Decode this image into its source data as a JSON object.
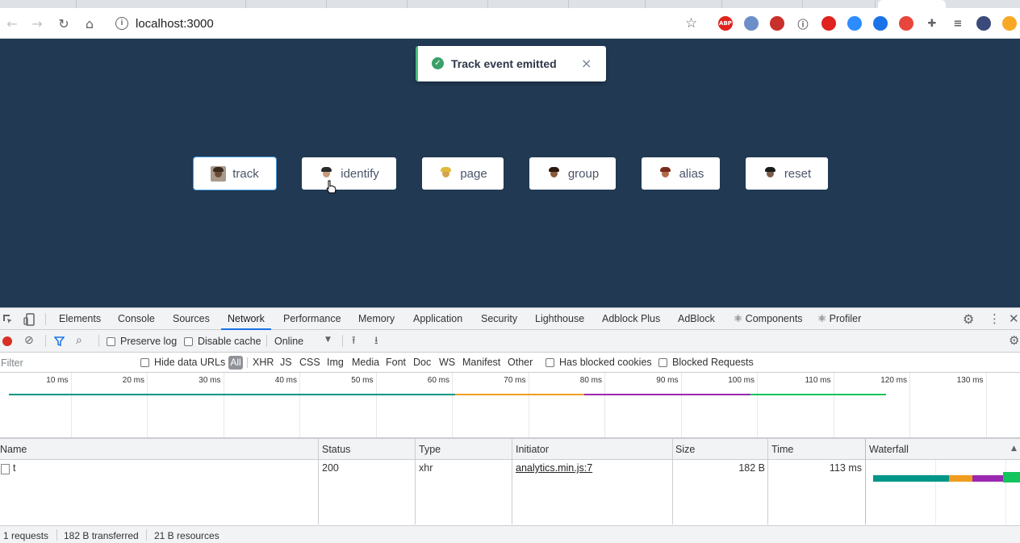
{
  "browser": {
    "url": "localhost:3000",
    "icons": {
      "back": "arrow-left-icon",
      "forward": "arrow-right-icon",
      "reload": "reload-icon",
      "home": "home-icon",
      "site_info": "info-icon",
      "bookmark": "star-icon"
    },
    "extensions": [
      {
        "name": "adblock-plus-icon",
        "label": "ABP",
        "color": "#e0231e"
      },
      {
        "name": "extension-blue-icon",
        "label": "",
        "color": "#6d8fc8"
      },
      {
        "name": "extension-red-square-icon",
        "label": "",
        "color": "#c8302c"
      },
      {
        "name": "info-circle-ext-icon",
        "label": "i",
        "color": "#5f6368"
      },
      {
        "name": "adblock-icon",
        "label": "",
        "color": "#e0231e"
      },
      {
        "name": "zoom-icon",
        "label": "",
        "color": "#2d8cff"
      },
      {
        "name": "circle-ext-icon",
        "label": "",
        "color": "#1a73e8"
      },
      {
        "name": "spiral-ext-icon",
        "label": "",
        "color": "#e8453c"
      },
      {
        "name": "puzzle-icon",
        "label": "",
        "color": "#5f6368"
      },
      {
        "name": "media-playlist-icon",
        "label": "",
        "color": "#5f6368"
      },
      {
        "name": "profile-avatar",
        "label": "",
        "color": "#3b4a7a"
      },
      {
        "name": "update-icon",
        "label": "",
        "color": "#f9a825"
      }
    ]
  },
  "app": {
    "toast": {
      "message": "Track event emitted",
      "close": "×",
      "icon": "check-circle-icon",
      "color": "#48bb78"
    },
    "buttons": [
      {
        "label": "track"
      },
      {
        "label": "identify"
      },
      {
        "label": "page"
      },
      {
        "label": "group"
      },
      {
        "label": "alias"
      },
      {
        "label": "reset"
      }
    ]
  },
  "devtools": {
    "tabs": [
      "Elements",
      "Console",
      "Sources",
      "Network",
      "Performance",
      "Memory",
      "Application",
      "Security",
      "Lighthouse",
      "Adblock Plus",
      "AdBlock",
      "⚛ Components",
      "⚛ Profiler"
    ],
    "active_tab": "Network",
    "toolbar": {
      "preserve_log": "Preserve log",
      "disable_cache": "Disable cache",
      "throttle": "Online"
    },
    "filter": {
      "placeholder": "Filter",
      "hide_data_urls": "Hide data URLs",
      "types": [
        "All",
        "XHR",
        "JS",
        "CSS",
        "Img",
        "Media",
        "Font",
        "Doc",
        "WS",
        "Manifest",
        "Other"
      ],
      "has_blocked_cookies": "Has blocked cookies",
      "blocked_requests": "Blocked Requests"
    },
    "timeline_ticks": [
      "10 ms",
      "20 ms",
      "30 ms",
      "40 ms",
      "50 ms",
      "60 ms",
      "70 ms",
      "80 ms",
      "90 ms",
      "100 ms",
      "110 ms",
      "120 ms",
      "130 ms"
    ],
    "timeline_colors": {
      "waiting": "#009688",
      "receiving": "#f09c1e",
      "content": "#9c27b0",
      "done": "#13c45d"
    },
    "columns": [
      "Name",
      "Status",
      "Type",
      "Initiator",
      "Size",
      "Time",
      "Waterfall"
    ],
    "rows": [
      {
        "name": "t",
        "status": "200",
        "type": "xhr",
        "initiator": "analytics.min.js:7",
        "size": "182 B",
        "time": "113 ms"
      }
    ],
    "status_bar": {
      "requests": "1 requests",
      "transferred": "182 B transferred",
      "resources": "21 B resources"
    }
  }
}
